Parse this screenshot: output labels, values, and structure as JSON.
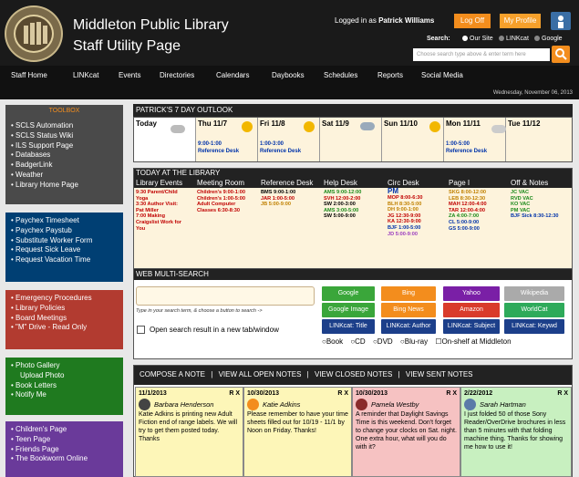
{
  "header": {
    "title_line1": "Middleton Public Library",
    "title_line2": "Staff Utility Page",
    "login_prefix": "Logged in as",
    "user_name": "Patrick Williams",
    "logoff_label": "Log Off",
    "profile_label": "My Profile",
    "search_label": "Search:",
    "search_options": [
      "Our Site",
      "LINKcat",
      "Google"
    ],
    "search_placeholder": "Choose search type above & enter term here",
    "logo_text": "MIDDLETON PUBLIC LIBRARY"
  },
  "nav": [
    "Staff Home",
    "LINKcat",
    "Events",
    "Directories",
    "Calendars",
    "Daybooks",
    "Schedules",
    "Reports",
    "Social Media"
  ],
  "date": "Wednesday, November 06, 2013",
  "toolbox": {
    "title": "TOOLBOX",
    "group1": [
      "SCLS Automation",
      "SCLS Status Wiki",
      "ILS Support Page",
      "Databases",
      "BadgerLink",
      "Weather",
      "Library Home Page"
    ],
    "group2": [
      "Paychex Timesheet",
      "Paychex Paystub",
      "Substitute Worker Form",
      "Request Sick Leave",
      "Request Vacation Time"
    ],
    "group3": [
      "Emergency Procedures",
      "Library Policies",
      "Board Meetings",
      "\"M\" Drive - Read Only"
    ],
    "group4": [
      "Photo Gallery",
      "Upload Photo",
      "Book Letters",
      "Notify Me"
    ],
    "group5": [
      "Children's Page",
      "Teen Page",
      "Friends Page",
      "The Bookworm Online"
    ]
  },
  "outlook": {
    "title": "PATRICK'S 7 DAY OUTLOOK",
    "days": [
      {
        "name": "Today",
        "events": []
      },
      {
        "name": "Thu 11/7",
        "events": [
          "9:00-1:00",
          "Reference Desk"
        ]
      },
      {
        "name": "Fri 11/8",
        "events": [
          "1:00-3:00",
          "Reference Desk"
        ]
      },
      {
        "name": "Sat 11/9",
        "events": []
      },
      {
        "name": "Sun 11/10",
        "events": []
      },
      {
        "name": "Mon 11/11",
        "events": [
          "1:00-5:00",
          "Reference Desk"
        ]
      },
      {
        "name": "Tue 11/12",
        "events": []
      }
    ]
  },
  "today": {
    "title": "TODAY AT THE LIBRARY",
    "columns": [
      {
        "header": "Library Events",
        "lines": [
          "9:30 Parent/Child",
          "Yoga",
          "3:30 Author Visit:",
          "Pat Miller",
          "7:00 Making",
          "Craigslist Work for",
          "You"
        ]
      },
      {
        "header": "Meeting Room",
        "lines": [
          "Children's 9:00-1:00",
          "Children's 1:00-5:00",
          "Adult Computer",
          "Classes 6:30-8:30"
        ]
      },
      {
        "header": "Reference Desk",
        "lines": [
          "BMS 9:00-1:00",
          "JAR 1:00-5:00",
          "JB 5:00-9:00"
        ]
      },
      {
        "header": "Help Desk",
        "lines": [
          "AMS 9:00-12:00",
          "SVH 12:00-2:00",
          "SW 2:00-3:00",
          "AMS 3:00-5:00",
          "SW 5:00-9:00"
        ]
      },
      {
        "header": "Circ Desk",
        "lines": [
          "PM",
          "MOP 8:00-6:30",
          "BLH 8:30-5:00",
          "DH 9:00-1:00",
          "JG 12:30-9:00",
          "KA 12:30-9:00",
          "BJF 1:00-5:00",
          "JD 5:00-9:00"
        ]
      },
      {
        "header": "Page I",
        "lines": [
          "SKG 8:00-12:00",
          "LEB 8:30-12:30",
          "MAH 12:00-4:00",
          "TAR 12:00-4:00",
          "ZA 4:00-7:00",
          "CL 5:00-9:00",
          "GS 5:00-9:00"
        ]
      },
      {
        "header": "Off & Notes",
        "lines": [
          "JC VAC",
          "RVD VAC",
          "KO VAC",
          "PM VAC",
          "BJF Sick 8:30-12:30"
        ]
      }
    ]
  },
  "multisearch": {
    "title": "WEB MULTI-SEARCH",
    "hint": "Type in your search term, & choose a button to search ->",
    "new_tab_label": "Open search result in a new tab/window",
    "buttons": [
      "Google",
      "Bing",
      "Yahoo",
      "Wikipedia",
      "Google Image",
      "Bing News",
      "Amazon",
      "WorldCat",
      "LINKcat: Title",
      "LINKcat: Author",
      "LINKcat: Subject",
      "LINKcat: Keywd"
    ],
    "formats": [
      "Book",
      "CD",
      "DVD",
      "Blu-ray",
      "On-shelf at Middleton"
    ]
  },
  "notes": {
    "tabs": [
      "COMPOSE A NOTE",
      "VIEW ALL OPEN NOTES",
      "VIEW CLOSED NOTES",
      "VIEW SENT NOTES"
    ],
    "separator": "|",
    "rx": "R X",
    "items": [
      {
        "date": "11/1/2013",
        "author": "Barbara Henderson",
        "text": "Katie Adkins is printing new Adult Fiction end of range labels. We will try to get them posted today. Thanks"
      },
      {
        "date": "10/30/2013",
        "author": "Katie Adkins",
        "text": "Please remember to have your time sheets filled out for 10/19 - 11/1 by Noon on Friday. Thanks!"
      },
      {
        "date": "10/30/2013",
        "author": "Pamela Westby",
        "text": "A reminder that Daylight Savings Time is this weekend. Don't forget to change your clocks on Sat. night. One extra hour, what will you do with it?"
      },
      {
        "date": "2/22/2012",
        "author": "Sarah Hartman",
        "text": "I just folded 50 of those Sony Reader/OverDrive brochures in less than 5 minutes with that folding machine thing. Thanks for showing me how to use it!"
      }
    ]
  },
  "colors": {
    "orange": "#f38d1d",
    "purple": "#9b3dbf"
  }
}
